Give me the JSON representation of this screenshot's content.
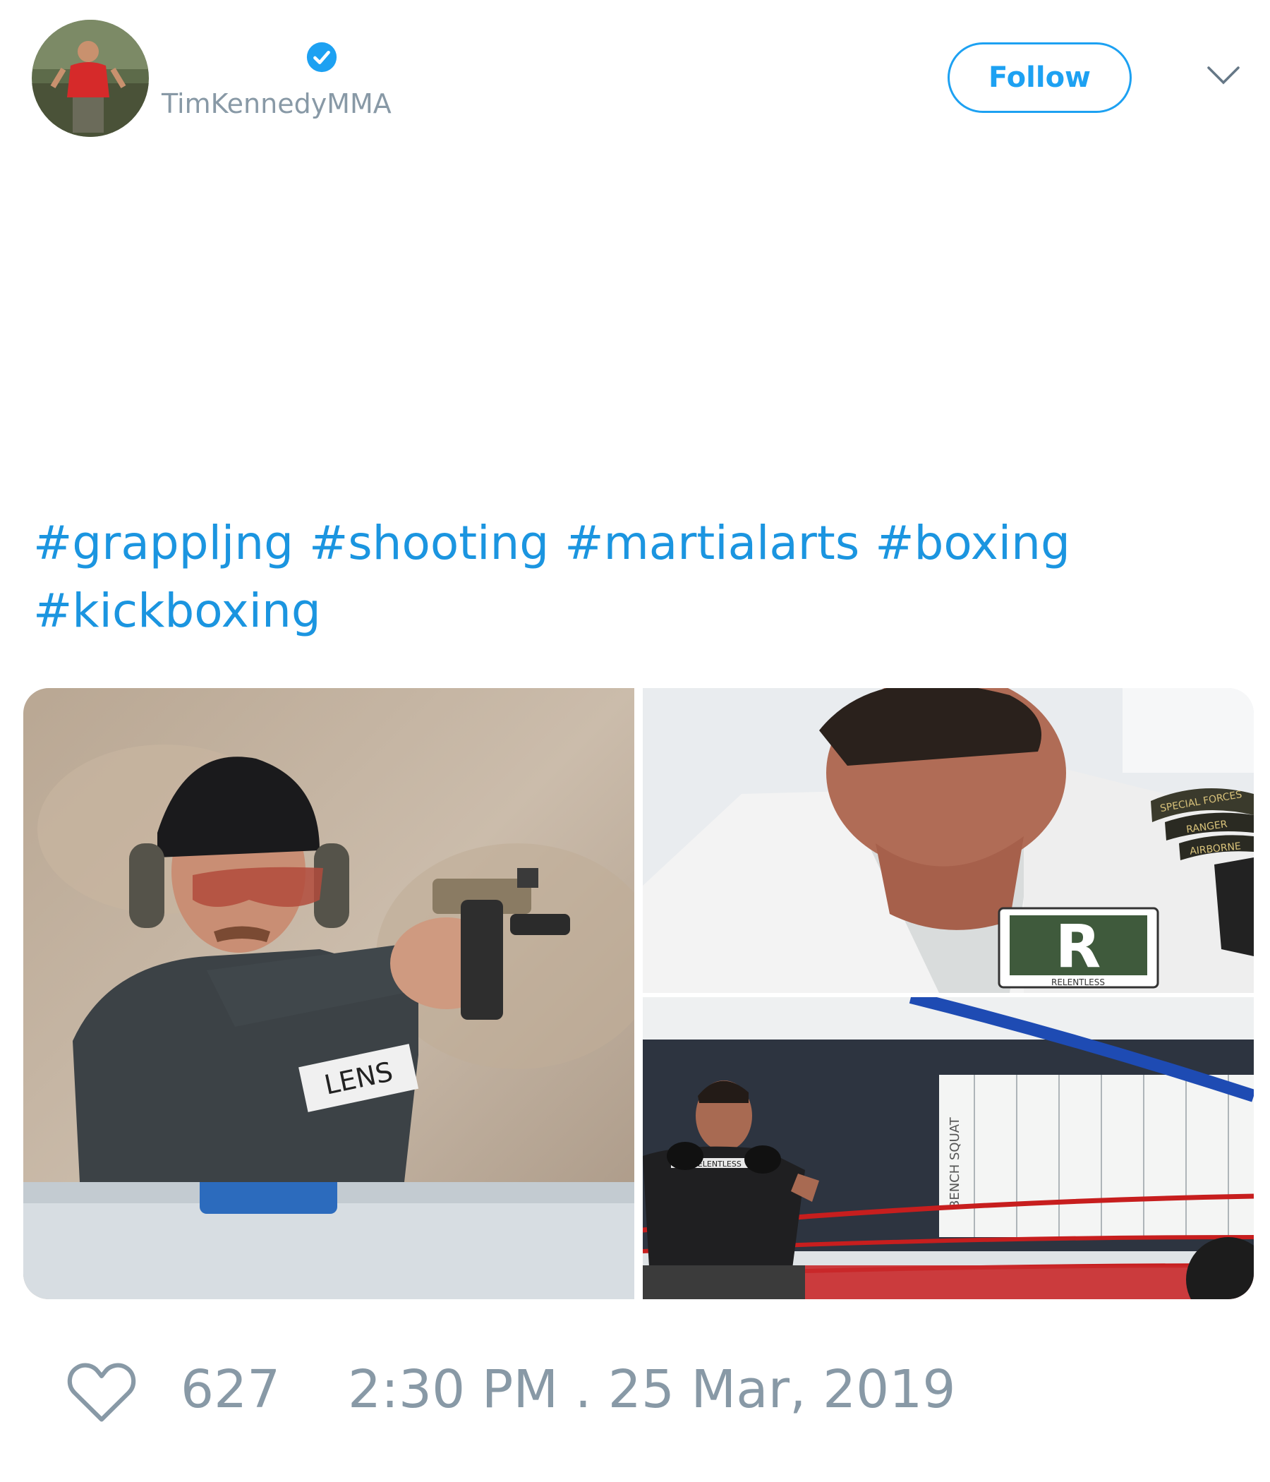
{
  "header": {
    "avatar_icon": "profile-photo",
    "verified_icon": "verified-badge-icon",
    "handle": "TimKennedyMMA",
    "follow_label": "Follow",
    "menu_icon": "chevron-down-icon"
  },
  "tweet": {
    "hashtags": [
      "#grappljng",
      "#shooting",
      "#martialarts",
      "#boxing",
      "#kickboxing"
    ]
  },
  "media": {
    "photos": [
      {
        "description_icon": "photo-shooting-range"
      },
      {
        "description_icon": "photo-jiu-jitsu-gi",
        "patch_text": "RELENTLESS",
        "patch_letter": "R",
        "tab_text": "SPECIAL FORCES",
        "tab_text_2": "RANGER",
        "tab_text_3": "AIRBORNE"
      },
      {
        "description_icon": "photo-boxing-ring",
        "board_text": "BENCH SQUAT",
        "shirt_text": "RELENTLESS"
      }
    ],
    "shirt_text_1": "LENS"
  },
  "footer": {
    "like_icon": "heart-icon",
    "likes": "627",
    "timestamp": "2:30 PM . 25 Mar, 2019"
  },
  "colors": {
    "link": "#1b95e0",
    "follow": "#1da1f2",
    "muted": "#8899a6"
  }
}
